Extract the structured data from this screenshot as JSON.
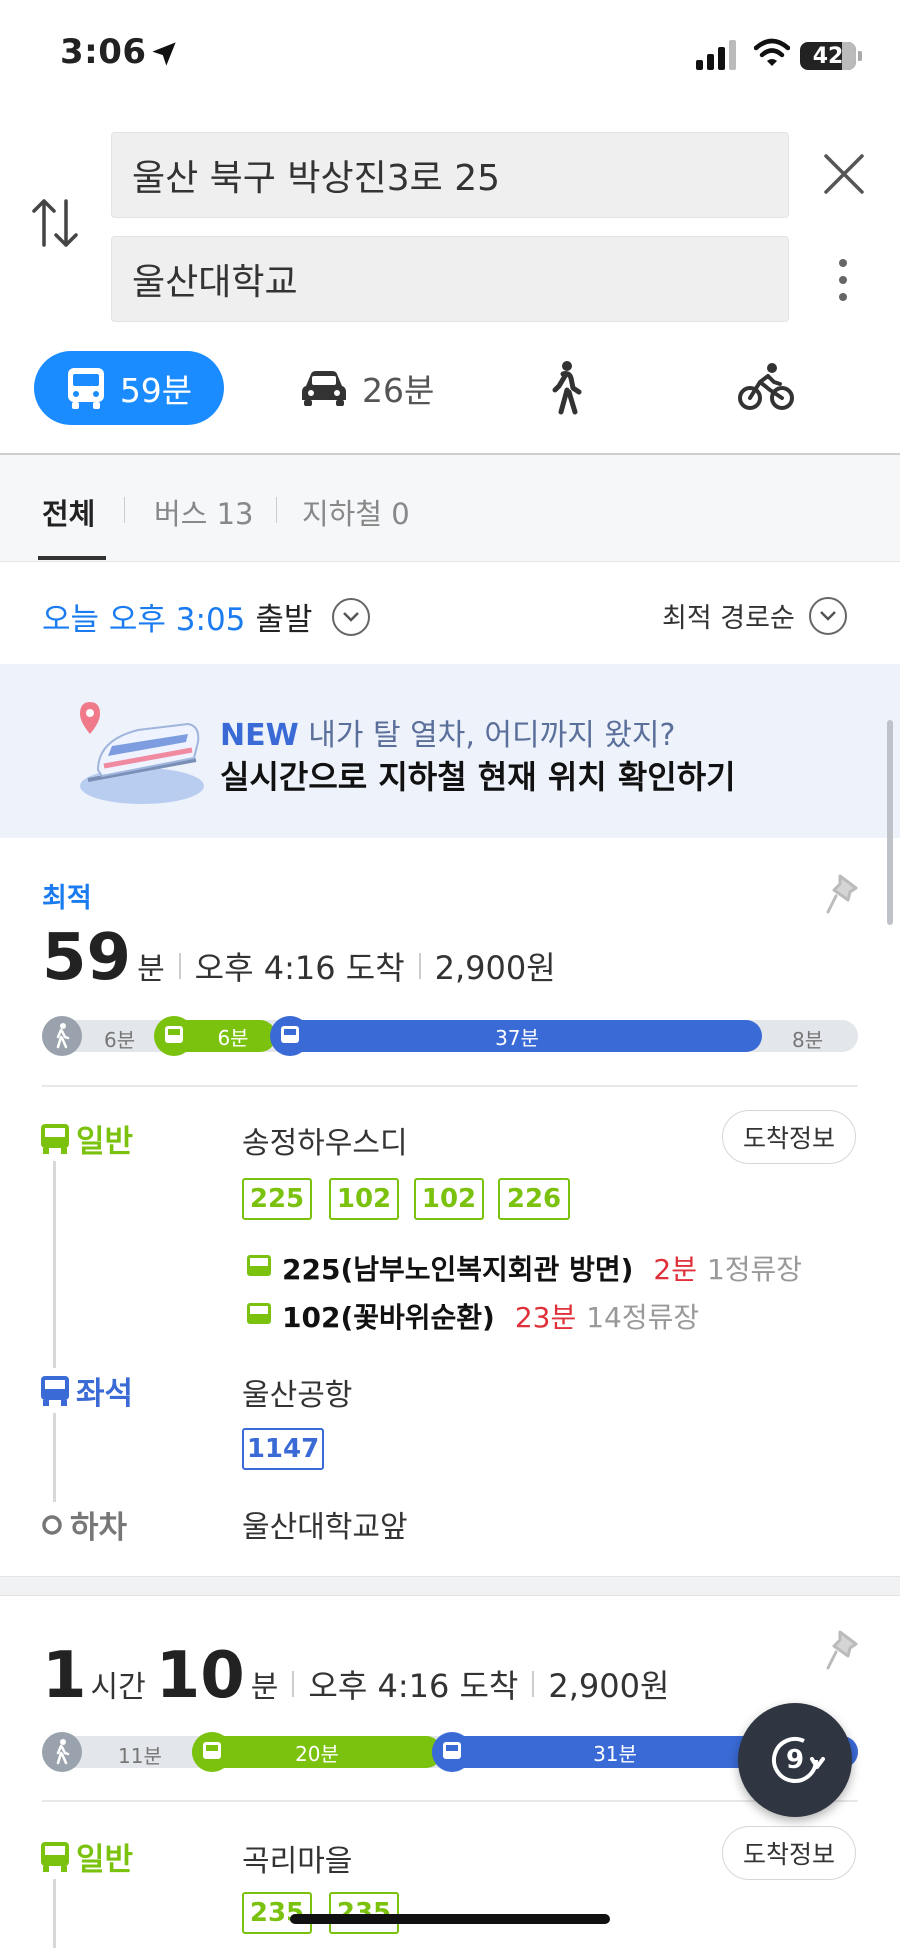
{
  "status_bar": {
    "time": "3:06",
    "battery": "42"
  },
  "search": {
    "origin": "울산 북구 박상진3로 25",
    "destination": "울산대학교"
  },
  "modes": {
    "transit_time": "59분",
    "car_time": "26분"
  },
  "tabs": [
    {
      "label": "전체"
    },
    {
      "label": "버스 13"
    },
    {
      "label": "지하철 0"
    }
  ],
  "departure": {
    "highlight": "오늘 오후 3:05",
    "suffix": "출발",
    "sort_label": "최적 경로순"
  },
  "banner": {
    "new_tag": "NEW",
    "line1": "내가 탈 열차, 어디까지 왔지?",
    "line2": "실시간으로 지하철 현재 위치 확인하기"
  },
  "routes": [
    {
      "tag": "최적",
      "minutes": "59",
      "minutes_unit": "분",
      "arrival": "오후 4:16 도착",
      "fare": "2,900원",
      "segments": {
        "walk1": "6분",
        "bus1": "6분",
        "bus2": "37분",
        "walk2": "8분"
      },
      "steps": {
        "step1_type": "일반",
        "step1_stop": "송정하우스디",
        "arrival_info_label": "도착정보",
        "step1_chips": [
          "225",
          "102",
          "102",
          "226"
        ],
        "arrivals": [
          {
            "name": "225(남부노인복지회관 방면)",
            "eta": "2분",
            "stops": "1정류장"
          },
          {
            "name": "102(꽃바위순환)",
            "eta": "23분",
            "stops": "14정류장"
          }
        ],
        "step2_type": "좌석",
        "step2_stop": "울산공항",
        "step2_chip": "1147",
        "step3_type": "하차",
        "step3_stop": "울산대학교앞"
      }
    },
    {
      "hours": "1",
      "hours_unit": "시간",
      "minutes": "10",
      "minutes_unit": "분",
      "arrival": "오후 4:16 도착",
      "fare": "2,900원",
      "segments": {
        "walk1": "11분",
        "bus1": "20분",
        "bus2": "31분"
      },
      "steps": {
        "step1_type": "일반",
        "step1_stop": "곡리마을",
        "arrival_info_label": "도착정보",
        "step1_chips": [
          "235",
          "235"
        ]
      }
    }
  ],
  "fab": {
    "count": "9"
  },
  "colors": {
    "accent_blue": "#1a8cff",
    "bus_green": "#7ac20e",
    "bus_blue": "#3a6ad6",
    "eta_red": "#e0303a"
  }
}
